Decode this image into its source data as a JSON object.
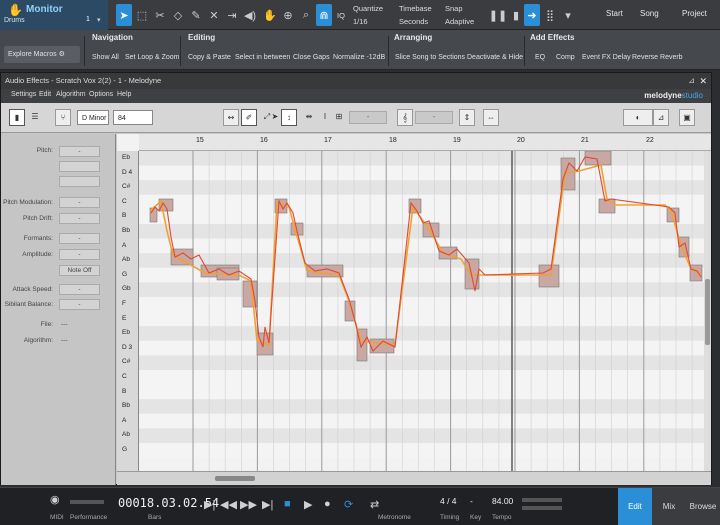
{
  "toolbar": {
    "track_title": "Monitor",
    "track_name": "Drums",
    "track_number": "1",
    "quantize_label": "Quantize",
    "quantize_value": "1/16",
    "iq_label": "IQ",
    "timebase_label": "Timebase",
    "timebase_value": "Seconds",
    "snap_label": "Snap",
    "snap_value": "Adaptive",
    "start_label": "Start",
    "song_label": "Song",
    "project_label": "Project"
  },
  "macros": {
    "explore": "Explore Macros",
    "groups": [
      {
        "title": "Navigation",
        "buttons": [
          "Show All",
          "Set Loop & Zoom"
        ]
      },
      {
        "title": "Editing",
        "buttons": [
          "Copy & Paste",
          "Select in between",
          "Close Gaps",
          "Normalize -12dB"
        ]
      },
      {
        "title": "Arranging",
        "buttons": [
          "Slice Song to Sections",
          "Deactivate & Hide"
        ]
      },
      {
        "title": "Add Effects",
        "buttons": [
          "EQ",
          "Comp",
          "Event FX Delay",
          "Reverse Reverb"
        ]
      }
    ]
  },
  "editor_window": {
    "title": "Audio Effects - Scratch Vox 2(2) - 1 - Melodyne",
    "menus": [
      "Settings",
      "Edit",
      "Algorithm",
      "Options",
      "Help"
    ],
    "logo_main": "melodyne",
    "logo_edition": "studio",
    "key": "D Minor",
    "tempo": "84",
    "left_panel": {
      "pitch_label": "Pitch:",
      "pitch_value": "-",
      "pitch_modulation_label": "Pitch Modulation:",
      "pitch_modulation_value": "-",
      "pitch_drift_label": "Pitch Drift:",
      "pitch_drift_value": "-",
      "formants_label": "Formants:",
      "formants_value": "-",
      "amplitude_label": "Amplitude:",
      "amplitude_value": "-",
      "note_off_label": "Note Off",
      "attack_speed_label": "Attack Speed:",
      "attack_speed_value": "-",
      "sibilant_balance_label": "Sibilant Balance:",
      "sibilant_balance_value": "-",
      "file_label": "File:",
      "file_value": "---",
      "algorithm_label": "Algorithm:",
      "algorithm_value": "---"
    },
    "bars": [
      "15",
      "16",
      "17",
      "18",
      "19",
      "20",
      "21",
      "22"
    ],
    "note_names": [
      "Eb",
      "D 4",
      "C#",
      "C",
      "B",
      "Bb",
      "A",
      "Ab",
      "G",
      "Gb",
      "F",
      "E",
      "Eb",
      "D 3",
      "C#",
      "C",
      "B",
      "Bb",
      "A",
      "Ab",
      "G"
    ]
  },
  "transport": {
    "midi_label": "MIDI",
    "performance_label": "Performance",
    "time": "00018.03.02.54",
    "time_unit": "Bars",
    "metronome_label": "Metronome",
    "timing_label": "Timing",
    "timing_value": "4 / 4",
    "key_label": "Key",
    "key_value": "-",
    "tempo_label": "Tempo",
    "tempo_value": "84.00",
    "edit_label": "Edit",
    "mix_label": "Mix",
    "browse_label": "Browse"
  },
  "colors": {
    "accent": "#2b8fd8",
    "blob_fill": "#c9a7a2",
    "pitch_curve": "#e0492f",
    "pitch_line": "#f1a133"
  }
}
